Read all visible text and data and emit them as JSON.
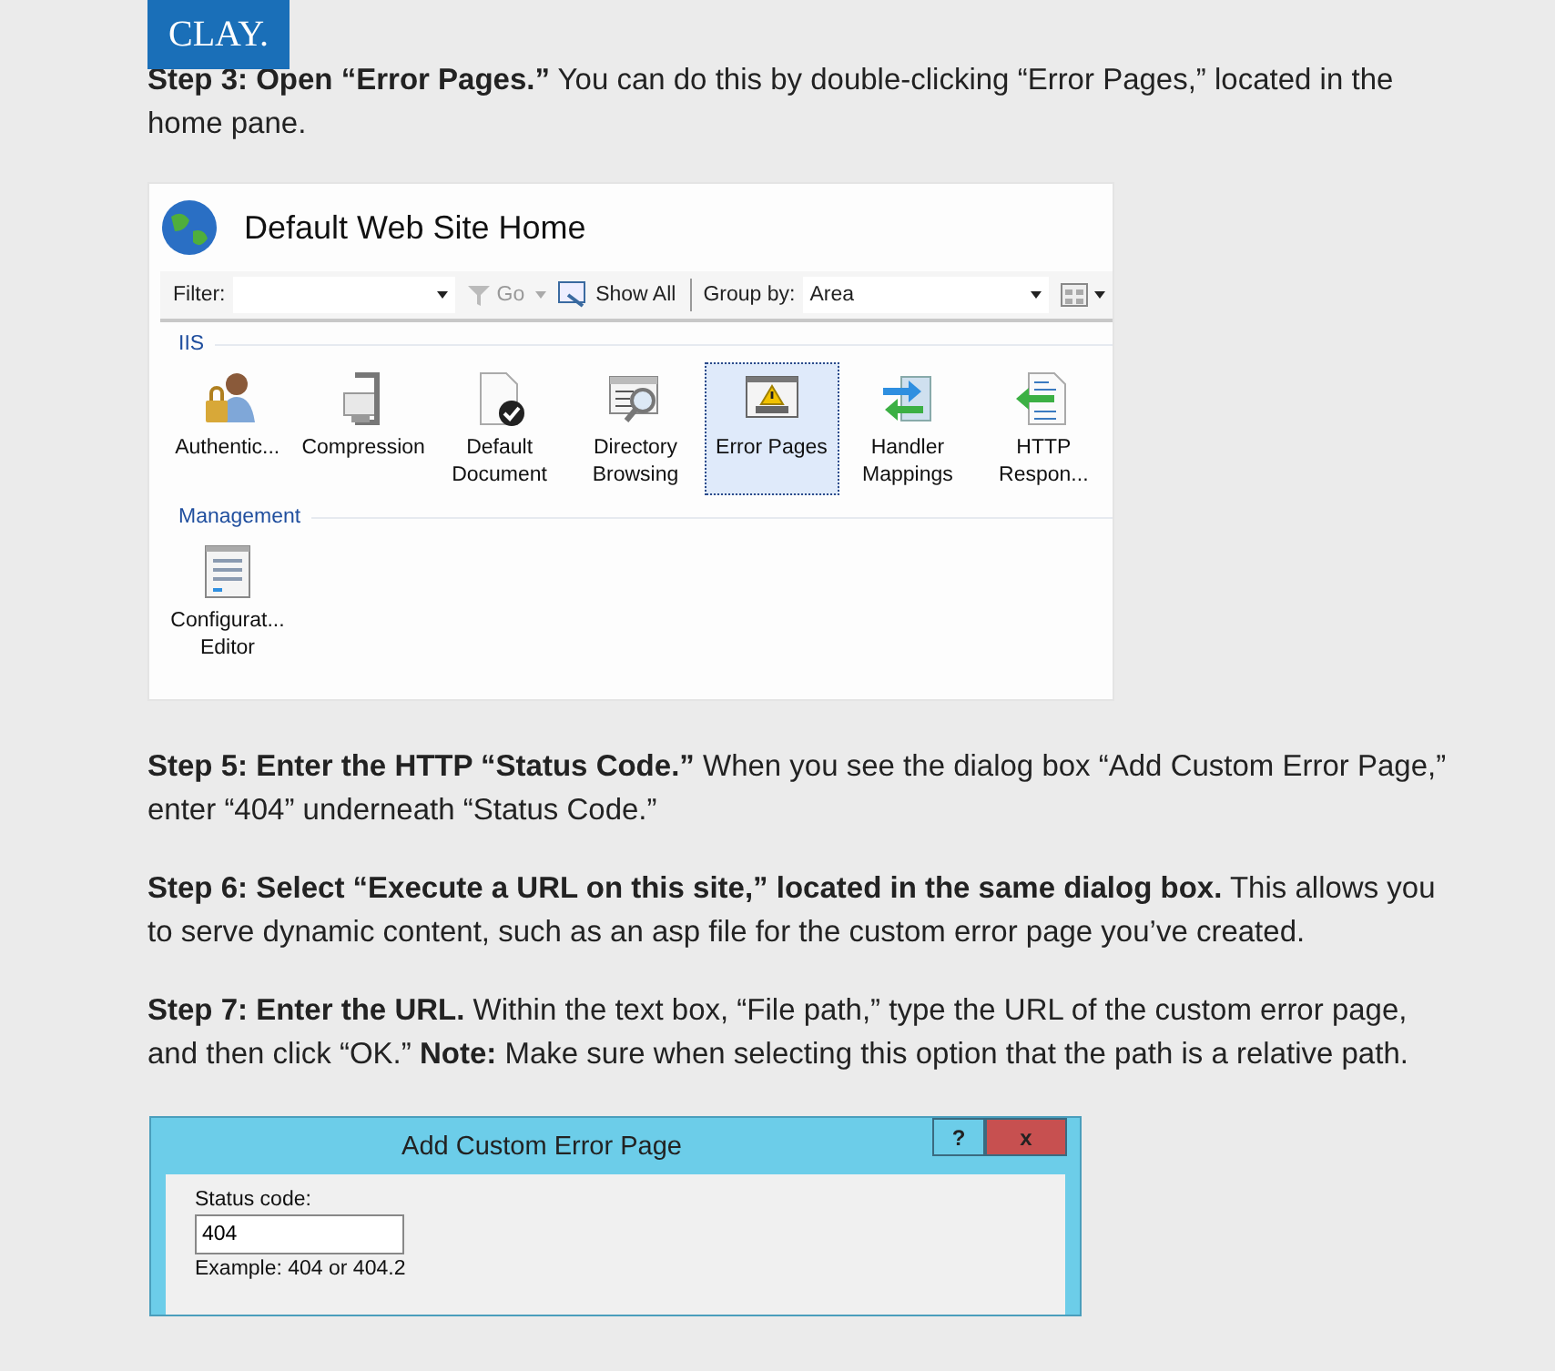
{
  "header": {
    "logo": "CLAY."
  },
  "intro": "**Step 3: Open “Error Pages.”** You can do this by double-clicking “Error Pages,” located in the home pane.",
  "iis_screenshot": {
    "title": "Default Web Site Home",
    "toolbar": {
      "filter_label": "Filter:",
      "go": "Go",
      "show_all": "Show All",
      "group_by_label": "Group by:",
      "group_by_value": "Area"
    },
    "groups": [
      {
        "name": "IIS",
        "items": [
          {
            "label": "Authentic...",
            "kind": "lock",
            "selected": false
          },
          {
            "label": "Compression",
            "kind": "clamp",
            "selected": false
          },
          {
            "label": "Default Document",
            "kind": "document",
            "selected": false
          },
          {
            "label": "Directory Browsing",
            "kind": "browse",
            "selected": false
          },
          {
            "label": "Error Pages",
            "kind": "warning",
            "selected": true
          },
          {
            "label": "Handler Mappings",
            "kind": "arrows",
            "selected": false
          },
          {
            "label": "HTTP Respon...",
            "kind": "response",
            "selected": false
          }
        ]
      },
      {
        "name": "Management",
        "items": [
          {
            "label": "Configurat... Editor",
            "kind": "config",
            "selected": false
          }
        ]
      }
    ]
  },
  "steps": [
    "**Step 5: Enter the HTTP “Status Code.”** When you see the dialog box “Add Custom Error Page,” enter “404” underneath “Status Code.”",
    "**Step 6: Select “Execute a URL on this site,” located in the same dialog box.** This allows you to serve dynamic content, such as an asp file for the custom error page you’ve created.",
    "**Step 7: Enter the URL.** Within the text box, “File path,” type the URL of the custom error page, and then click “OK.” **Note:** Make sure when selecting this option that the path is a relative path."
  ],
  "dialog_screenshot": {
    "title": "Add Custom Error Page",
    "help": "?",
    "close": "x",
    "status_label": "Status code:",
    "status_value": "404",
    "example": "Example: 404 or 404.2"
  }
}
